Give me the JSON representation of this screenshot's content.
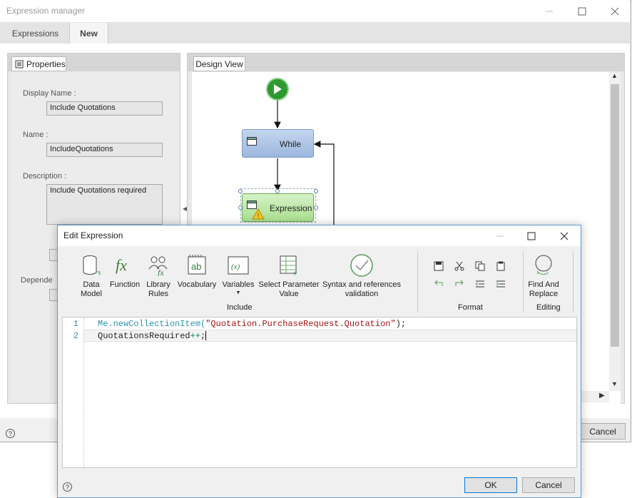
{
  "main_window": {
    "title": "Expression manager",
    "tabs": [
      {
        "label": "Expressions"
      },
      {
        "label": "New"
      }
    ],
    "properties_tab": "Properties",
    "design_tab": "Design View",
    "fields": {
      "display_name_label": "Display Name :",
      "display_name_value": "Include Quotations",
      "name_label": "Name :",
      "name_value": "IncludeQuotations",
      "description_label": "Description :",
      "description_value": "Include Quotations required",
      "dependencies_label": "Depende"
    },
    "flow": {
      "while_label": "While",
      "expression_label": "Expression"
    },
    "cancel_label": "Cancel",
    "help_glyph": "?"
  },
  "edit_dialog": {
    "title": "Edit Expression",
    "ribbon": {
      "include_items": [
        {
          "label": "Data\nModel",
          "icon": "database-icon"
        },
        {
          "label": "Function",
          "icon": "function-icon"
        },
        {
          "label": "Library\nRules",
          "icon": "library-rules-icon"
        },
        {
          "label": "Vocabulary",
          "icon": "vocabulary-icon"
        },
        {
          "label": "Variables",
          "icon": "variables-icon"
        },
        {
          "label": "Select Parameter\nValue",
          "icon": "select-parameter-icon"
        },
        {
          "label": "Syntax and references\nvalidation",
          "icon": "validation-icon"
        }
      ],
      "include_group": "Include",
      "format_group": "Format",
      "find_label": "Find And\nReplace",
      "editing_group": "Editing"
    },
    "code_lines": [
      {
        "num": "1",
        "me": "Me.newCollectionItem(",
        "str": "\"Quotation.PurchaseRequest.Quotation\"",
        "rest": ");"
      },
      {
        "num": "2",
        "ident": "QuotationsRequired",
        "op": "++",
        "rest": ";"
      }
    ],
    "ok_label": "OK",
    "cancel_label": "Cancel",
    "help_glyph": "?"
  }
}
